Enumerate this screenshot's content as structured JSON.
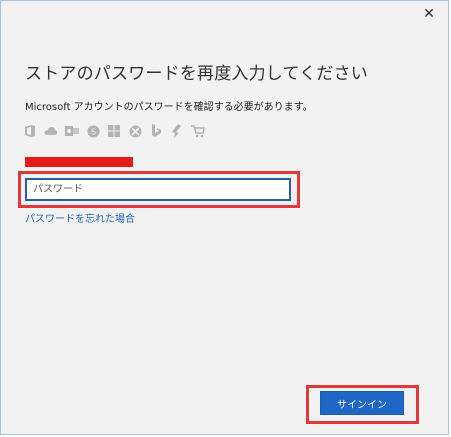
{
  "window": {
    "close_glyph": "✕"
  },
  "dialog": {
    "heading": "ストアのパスワードを再度入力してください",
    "subtext": "Microsoft アカウントのパスワードを確認する必要があります。",
    "service_icons": [
      "office-icon",
      "onedrive-icon",
      "outlook-icon",
      "skype-icon",
      "windows-icon",
      "xbox-icon",
      "bing-icon",
      "msn-icon",
      "store-cart-icon"
    ],
    "password_field": {
      "placeholder": "パスワード",
      "value": ""
    },
    "forgot_link": "パスワードを忘れた場合",
    "signin_button": "サインイン"
  },
  "colors": {
    "accent": "#1f67c7",
    "link": "#1a63b8",
    "highlight": "#e0393b",
    "redaction": "#e21b1b",
    "background": "#f2f2f2"
  }
}
